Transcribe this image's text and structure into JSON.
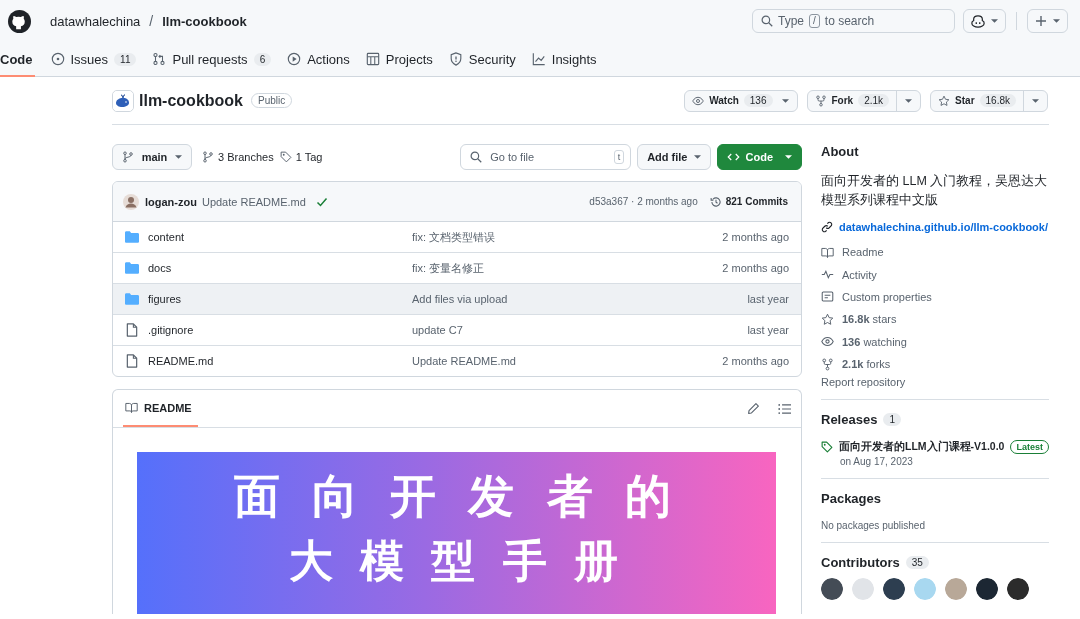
{
  "header": {
    "owner": "datawhalechina",
    "separator": "/",
    "repo": "llm-cookbook",
    "search": {
      "prefix": "Type",
      "key": "/",
      "suffix": "to search"
    }
  },
  "nav_tabs": [
    {
      "label": "Code",
      "selected": true
    },
    {
      "kind": "issues",
      "label": "Issues",
      "count": "11",
      "selected": false
    },
    {
      "kind": "pulls",
      "label": "Pull requests",
      "count": "6",
      "selected": false
    },
    {
      "kind": "actions",
      "label": "Actions",
      "selected": false
    },
    {
      "kind": "projects",
      "label": "Projects",
      "selected": false
    },
    {
      "kind": "security",
      "label": "Security",
      "selected": false
    },
    {
      "kind": "insights",
      "label": "Insights",
      "selected": false
    }
  ],
  "repo": {
    "name": "llm-cookbook",
    "visibility": "Public",
    "actions": [
      {
        "kind": "watch",
        "label": "Watch",
        "count": "136"
      },
      {
        "kind": "fork",
        "label": "Fork",
        "count": "2.1k"
      },
      {
        "kind": "star",
        "label": "Star",
        "count": "16.8k"
      }
    ]
  },
  "toolbar": {
    "branch": "main",
    "branches": "3 Branches",
    "tags": "1 Tag",
    "go_to_file": "Go to file",
    "shortcut": "t",
    "add_file": "Add file",
    "code": "Code"
  },
  "latest_commit": {
    "author": "logan-zou",
    "message": "Update README.md",
    "checks_passed": true,
    "hash_time": "d53a367 · 2 months ago",
    "commits": "821 Commits"
  },
  "files": [
    {
      "kind": "folder",
      "name": "content",
      "message": "fix: 文档类型错误",
      "time": "2 months ago",
      "hovered": false
    },
    {
      "kind": "folder",
      "name": "docs",
      "message": "fix: 变量名修正",
      "time": "2 months ago",
      "hovered": false
    },
    {
      "kind": "folder",
      "name": "figures",
      "message": "Add files via upload",
      "time": "last year",
      "hovered": true
    },
    {
      "kind": "file",
      "name": ".gitignore",
      "message": "update C7",
      "time": "last year",
      "hovered": false
    },
    {
      "kind": "file",
      "name": "README.md",
      "message": "Update README.md",
      "time": "2 months ago",
      "hovered": false
    }
  ],
  "readme": {
    "tab": "README",
    "banner_lines": [
      "面 向 开 发 者 的",
      "大 模 型 手 册"
    ]
  },
  "about": {
    "title": "About",
    "description": "面向开发者的 LLM 入门教程，吴恩达大模型系列课程中文版",
    "link": "datawhalechina.github.io/llm-cookbook/",
    "items": [
      {
        "kind": "readme",
        "text": "Readme"
      },
      {
        "kind": "activity",
        "text": "Activity"
      },
      {
        "kind": "properties",
        "text": "Custom properties"
      },
      {
        "kind": "stars",
        "text": "**16.8k** stars"
      },
      {
        "kind": "watching",
        "text": "**136** watching"
      },
      {
        "kind": "forks",
        "text": "**2.1k** forks"
      }
    ],
    "report": "Report repository"
  },
  "releases": {
    "title": "Releases",
    "count": "1",
    "name": "面向开发者的LLM入门课程-V1.0.0",
    "badge": "Latest",
    "date": "on Aug 17, 2023"
  },
  "packages": {
    "title": "Packages",
    "text": "No packages published"
  },
  "contributors": {
    "title": "Contributors",
    "count": "35"
  }
}
